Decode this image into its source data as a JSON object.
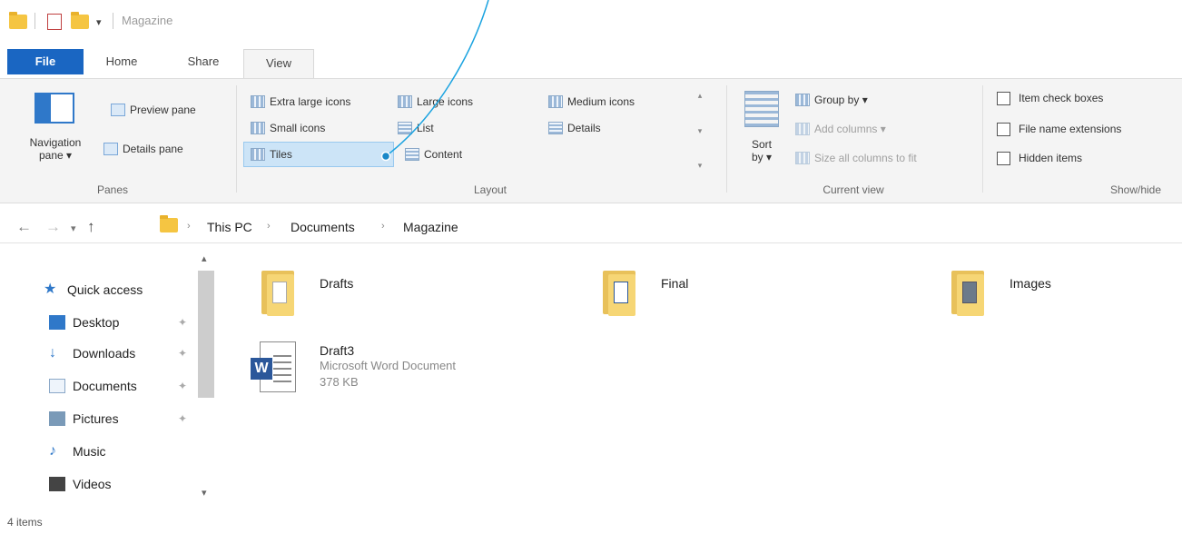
{
  "window": {
    "title": "Magazine"
  },
  "tabs": [
    "File",
    "Home",
    "Share",
    "View"
  ],
  "ribbon": {
    "panes": {
      "navigation_pane_label": "Navigation\npane ▾",
      "preview_pane": "Preview pane",
      "details_pane": "Details pane",
      "group_label": "Panes"
    },
    "layout": {
      "items": [
        "Extra large icons",
        "Large icons",
        "Medium icons",
        "Small icons",
        "List",
        "Details",
        "Tiles",
        "Content"
      ],
      "selected": "Tiles",
      "group_label": "Layout"
    },
    "current_view": {
      "sort_by": "Sort\nby ▾",
      "group_by": "Group by ▾",
      "add_columns": "Add columns ▾",
      "size_columns": "Size all columns to fit",
      "group_label": "Current view"
    },
    "show_hide": {
      "item_check_boxes": "Item check boxes",
      "file_name_extensions": "File name extensions",
      "hidden_items": "Hidden items",
      "group_label": "Show/hide"
    }
  },
  "address": {
    "crumbs": [
      "This PC",
      "Documents",
      "Magazine"
    ]
  },
  "nav": {
    "items": [
      {
        "label": "Quick access",
        "icon": "star-icon",
        "color": "#2f78c9"
      },
      {
        "label": "Desktop",
        "icon": "desktop-icon",
        "color": "#2f78c9"
      },
      {
        "label": "Downloads",
        "icon": "download-icon",
        "color": "#2f78c9"
      },
      {
        "label": "Documents",
        "icon": "documents-icon",
        "color": "#8aa8c8"
      },
      {
        "label": "Pictures",
        "icon": "pictures-icon",
        "color": "#7a9ab8"
      },
      {
        "label": "Music",
        "icon": "music-icon",
        "color": "#2f78c9"
      },
      {
        "label": "Videos",
        "icon": "videos-icon",
        "color": "#444444"
      }
    ]
  },
  "files": [
    {
      "name": "Drafts",
      "type": "folder"
    },
    {
      "name": "Final",
      "type": "folder"
    },
    {
      "name": "Images",
      "type": "folder"
    },
    {
      "name": "Draft3",
      "type": "Microsoft Word Document",
      "size": "378 KB"
    }
  ],
  "status": {
    "item_count": "4 items"
  },
  "colors": {
    "accent": "#1a66c2",
    "callout_line": "#1aa3e0",
    "selection": "#cce4f7"
  }
}
